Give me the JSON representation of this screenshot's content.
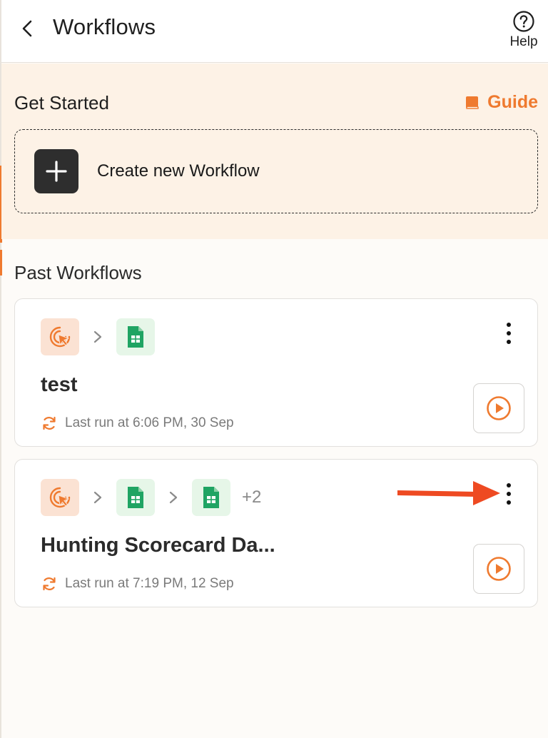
{
  "header": {
    "title": "Workflows",
    "help_label": "Help"
  },
  "get_started": {
    "title": "Get Started",
    "guide_label": "Guide",
    "create_label": "Create new Workflow"
  },
  "past": {
    "title": "Past Workflows",
    "workflows": [
      {
        "name": "test",
        "last_run": "Last run at 6:06 PM, 30 Sep",
        "apps": [
          "trigger-cursor-icon",
          "google-sheets-icon"
        ],
        "extra_count": ""
      },
      {
        "name": "Hunting Scorecard Da...",
        "last_run": "Last run at 7:19 PM, 12 Sep",
        "apps": [
          "trigger-cursor-icon",
          "google-sheets-icon",
          "google-sheets-icon"
        ],
        "extra_count": "+2"
      }
    ]
  },
  "colors": {
    "accent": "#ef7a2f",
    "annotation_arrow": "#ee4a22",
    "sheets_green": "#1fa463",
    "panel_bg": "#fdf2e6"
  }
}
